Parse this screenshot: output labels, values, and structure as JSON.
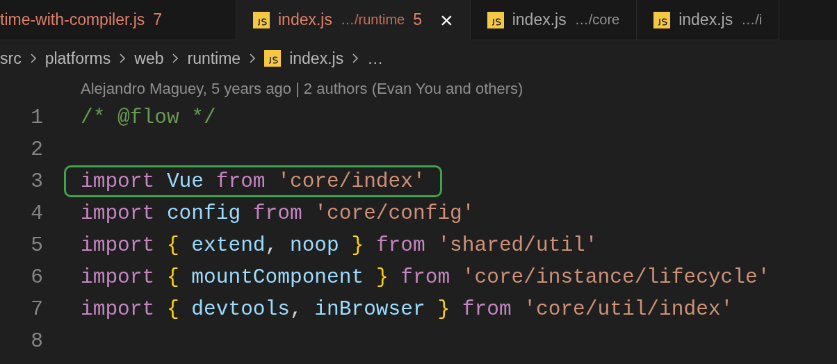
{
  "tabs": [
    {
      "name": "time-with-compiler.js",
      "problems": "7",
      "icon": false,
      "error": true,
      "selected": false
    },
    {
      "name": "index.js",
      "path": "…/runtime",
      "problems": "5",
      "icon": true,
      "error": true,
      "selected": true
    },
    {
      "name": "index.js",
      "path": "…/core",
      "icon": true,
      "error": false,
      "selected": false
    },
    {
      "name": "index.js",
      "path": "…/i",
      "icon": true,
      "error": false,
      "selected": false
    }
  ],
  "close_icon": "×",
  "breadcrumb": [
    {
      "label": "src",
      "icon": false
    },
    {
      "label": "platforms",
      "icon": false
    },
    {
      "label": "web",
      "icon": false
    },
    {
      "label": "runtime",
      "icon": false
    },
    {
      "label": "index.js",
      "icon": true
    },
    {
      "label": "…",
      "icon": false
    }
  ],
  "blame": "Alejandro Maguey, 5 years ago | 2 authors (Evan You and others)",
  "lines": [
    {
      "number": "1",
      "highlighted": false,
      "tokens": [
        {
          "kind": "comment",
          "text": "/* @flow */"
        }
      ]
    },
    {
      "number": "2",
      "highlighted": false
    },
    {
      "number": "3",
      "highlighted": true,
      "tokens": [
        {
          "kind": "keyword",
          "text": "import "
        },
        {
          "kind": "identifier",
          "text": "Vue "
        },
        {
          "kind": "keyword",
          "text": "from "
        },
        {
          "kind": "string",
          "text": "'core/index'"
        }
      ]
    },
    {
      "number": "4",
      "highlighted": false,
      "tokens": [
        {
          "kind": "keyword",
          "text": "import "
        },
        {
          "kind": "identifier",
          "text": "config "
        },
        {
          "kind": "keyword",
          "text": "from "
        },
        {
          "kind": "string",
          "text": "'core/config'"
        }
      ]
    },
    {
      "number": "5",
      "highlighted": false,
      "tokens": [
        {
          "kind": "keyword",
          "text": "import "
        },
        {
          "kind": "brace",
          "text": "{ "
        },
        {
          "kind": "identifier",
          "text": "extend"
        },
        {
          "kind": "plain",
          "text": ", "
        },
        {
          "kind": "identifier",
          "text": "noop "
        },
        {
          "kind": "brace",
          "text": "} "
        },
        {
          "kind": "keyword",
          "text": "from "
        },
        {
          "kind": "string",
          "text": "'shared/util'"
        }
      ]
    },
    {
      "number": "6",
      "highlighted": false,
      "tokens": [
        {
          "kind": "keyword",
          "text": "import "
        },
        {
          "kind": "brace",
          "text": "{ "
        },
        {
          "kind": "identifier",
          "text": "mountComponent "
        },
        {
          "kind": "brace",
          "text": "} "
        },
        {
          "kind": "keyword",
          "text": "from "
        },
        {
          "kind": "string",
          "text": "'core/instance/lifecycle'"
        }
      ]
    },
    {
      "number": "7",
      "highlighted": false,
      "tokens": [
        {
          "kind": "keyword",
          "text": "import "
        },
        {
          "kind": "brace",
          "text": "{ "
        },
        {
          "kind": "identifier",
          "text": "devtools"
        },
        {
          "kind": "plain",
          "text": ", "
        },
        {
          "kind": "identifier",
          "text": "inBrowser "
        },
        {
          "kind": "brace",
          "text": "} "
        },
        {
          "kind": "keyword",
          "text": "from "
        },
        {
          "kind": "string",
          "text": "'core/util/index'"
        }
      ]
    },
    {
      "number": "8",
      "highlighted": false
    }
  ]
}
